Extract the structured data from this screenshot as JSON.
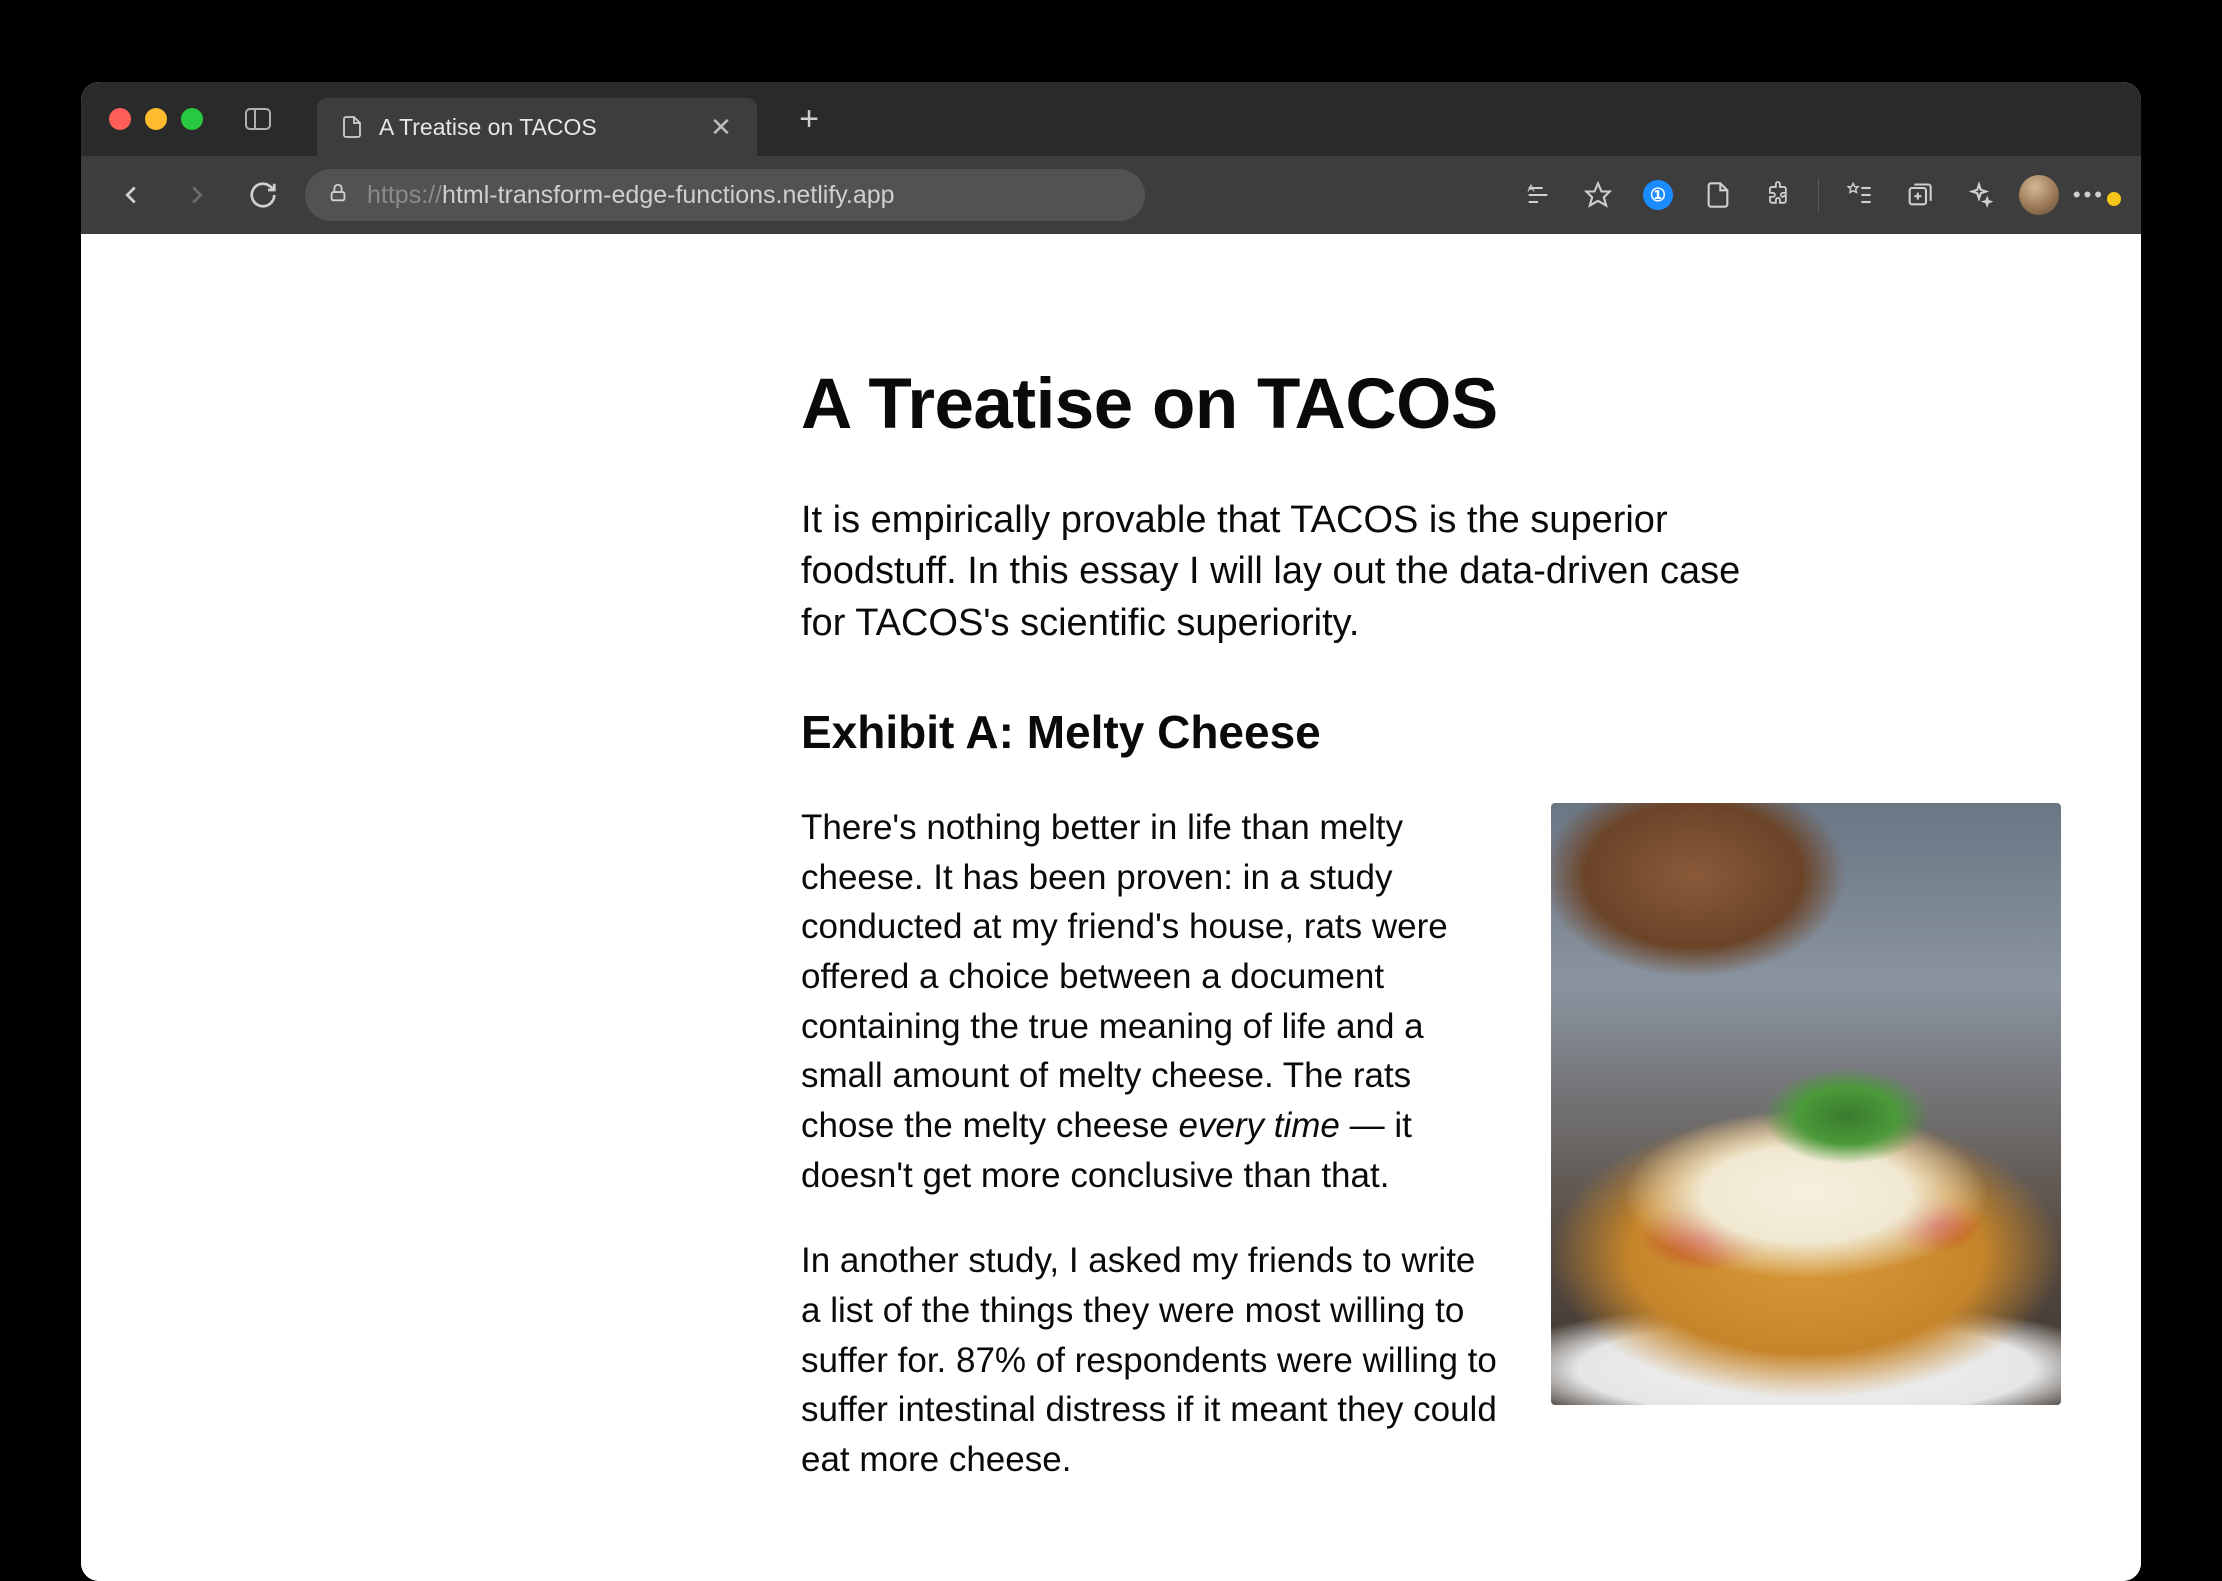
{
  "browser": {
    "tab_title": "A Treatise on TACOS",
    "url_scheme": "https://",
    "url_rest": "html-transform-edge-functions.netlify.app"
  },
  "page": {
    "h1": "A Treatise on TACOS",
    "lead": "It is empirically provable that TACOS is the superior foodstuff. In this essay I will lay out the data-driven case for TACOS's scientific superiority.",
    "h2": "Exhibit A: Melty Cheese",
    "para1_a": "There's nothing better in life than melty cheese. It has been proven: in a study conducted at my friend's house, rats were offered a choice between a document containing the true meaning of life and a small amount of melty cheese. The rats chose the melty cheese ",
    "para1_em": "every time",
    "para1_b": " — it doesn't get more conclusive than that.",
    "para2": "In another study, I asked my friends to write a list of the things they were most willing to suffer for. 87% of respondents were willing to suffer intestinal distress if it meant they could eat more cheese."
  }
}
